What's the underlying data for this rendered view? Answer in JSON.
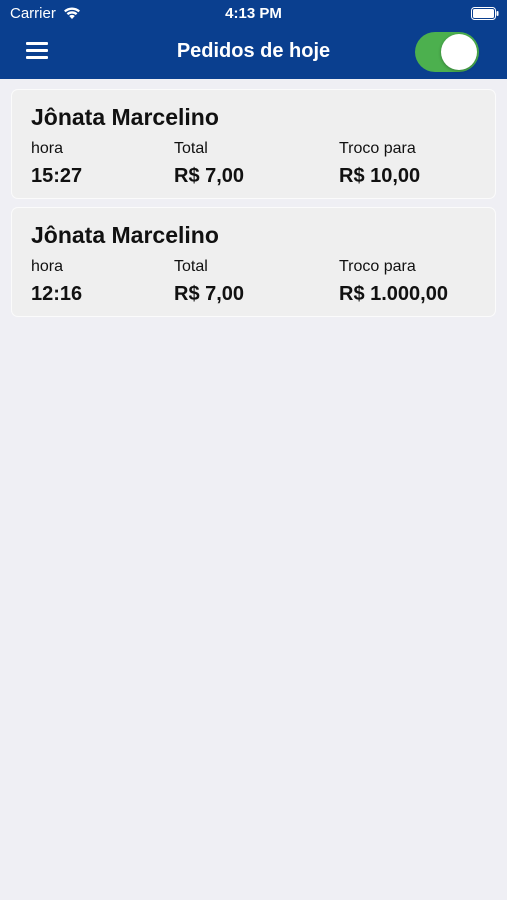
{
  "status": {
    "carrier": "Carrier",
    "time": "4:13 PM"
  },
  "navbar": {
    "title": "Pedidos de hoje",
    "toggle_on": true
  },
  "labels": {
    "hora": "hora",
    "total": "Total",
    "troco": "Troco para"
  },
  "orders": [
    {
      "name": "Jônata Marcelino",
      "hora": "15:27",
      "total": "R$ 7,00",
      "troco": "R$ 10,00"
    },
    {
      "name": "Jônata Marcelino",
      "hora": "12:16",
      "total": "R$ 7,00",
      "troco": "R$ 1.000,00"
    }
  ],
  "colors": {
    "header": "#0a3f8f",
    "toggle": "#4cb04e",
    "background": "#efeff4"
  }
}
